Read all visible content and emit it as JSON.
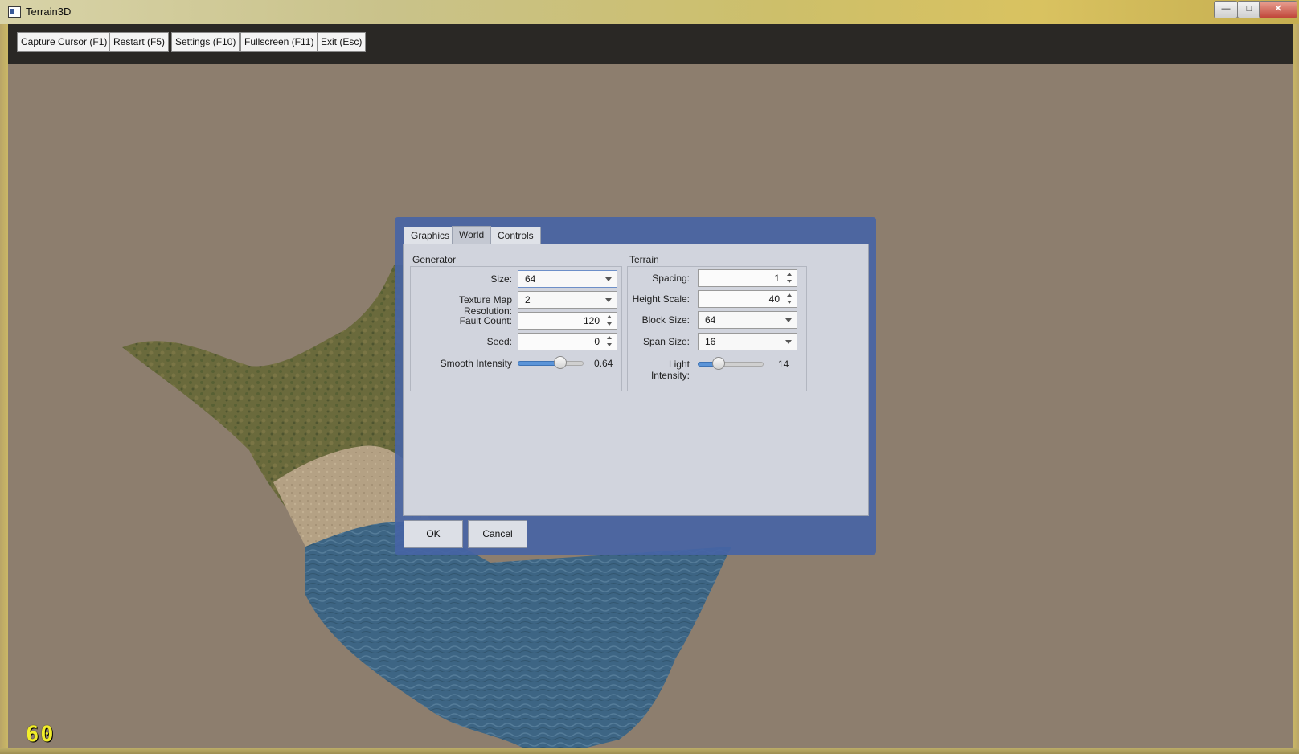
{
  "window": {
    "title": "Terrain3D",
    "minimize": "—",
    "maximize": "□",
    "close": "✕"
  },
  "toolbar": {
    "buttons": [
      "Capture Cursor (F1)",
      "Restart (F5)",
      "Settings (F10)",
      "Fullscreen (F11)",
      "Exit (Esc)"
    ]
  },
  "fps": "60",
  "dialog": {
    "tabs": [
      "Graphics",
      "World",
      "Controls"
    ],
    "active_tab": "World",
    "generator": {
      "title": "Generator",
      "size_label": "Size:",
      "size_value": "64",
      "texture_label": "Texture Map Resolution:",
      "texture_value": "2",
      "fault_label": "Fault Count:",
      "fault_value": "120",
      "seed_label": "Seed:",
      "seed_value": "0",
      "smooth_label": "Smooth Intensity",
      "smooth_value": "0.64",
      "smooth_fraction": 0.64
    },
    "terrain": {
      "title": "Terrain",
      "spacing_label": "Spacing:",
      "spacing_value": "1",
      "height_label": "Height Scale:",
      "height_value": "40",
      "block_label": "Block Size:",
      "block_value": "64",
      "span_label": "Span Size:",
      "span_value": "16",
      "light_label": "Light Intensity:",
      "light_value": "14",
      "light_fraction": 0.3
    },
    "ok": "OK",
    "cancel": "Cancel"
  },
  "colors": {
    "background": "#8d7e6e",
    "dialog": "#4664a5",
    "fps": "#f2ee2a"
  }
}
